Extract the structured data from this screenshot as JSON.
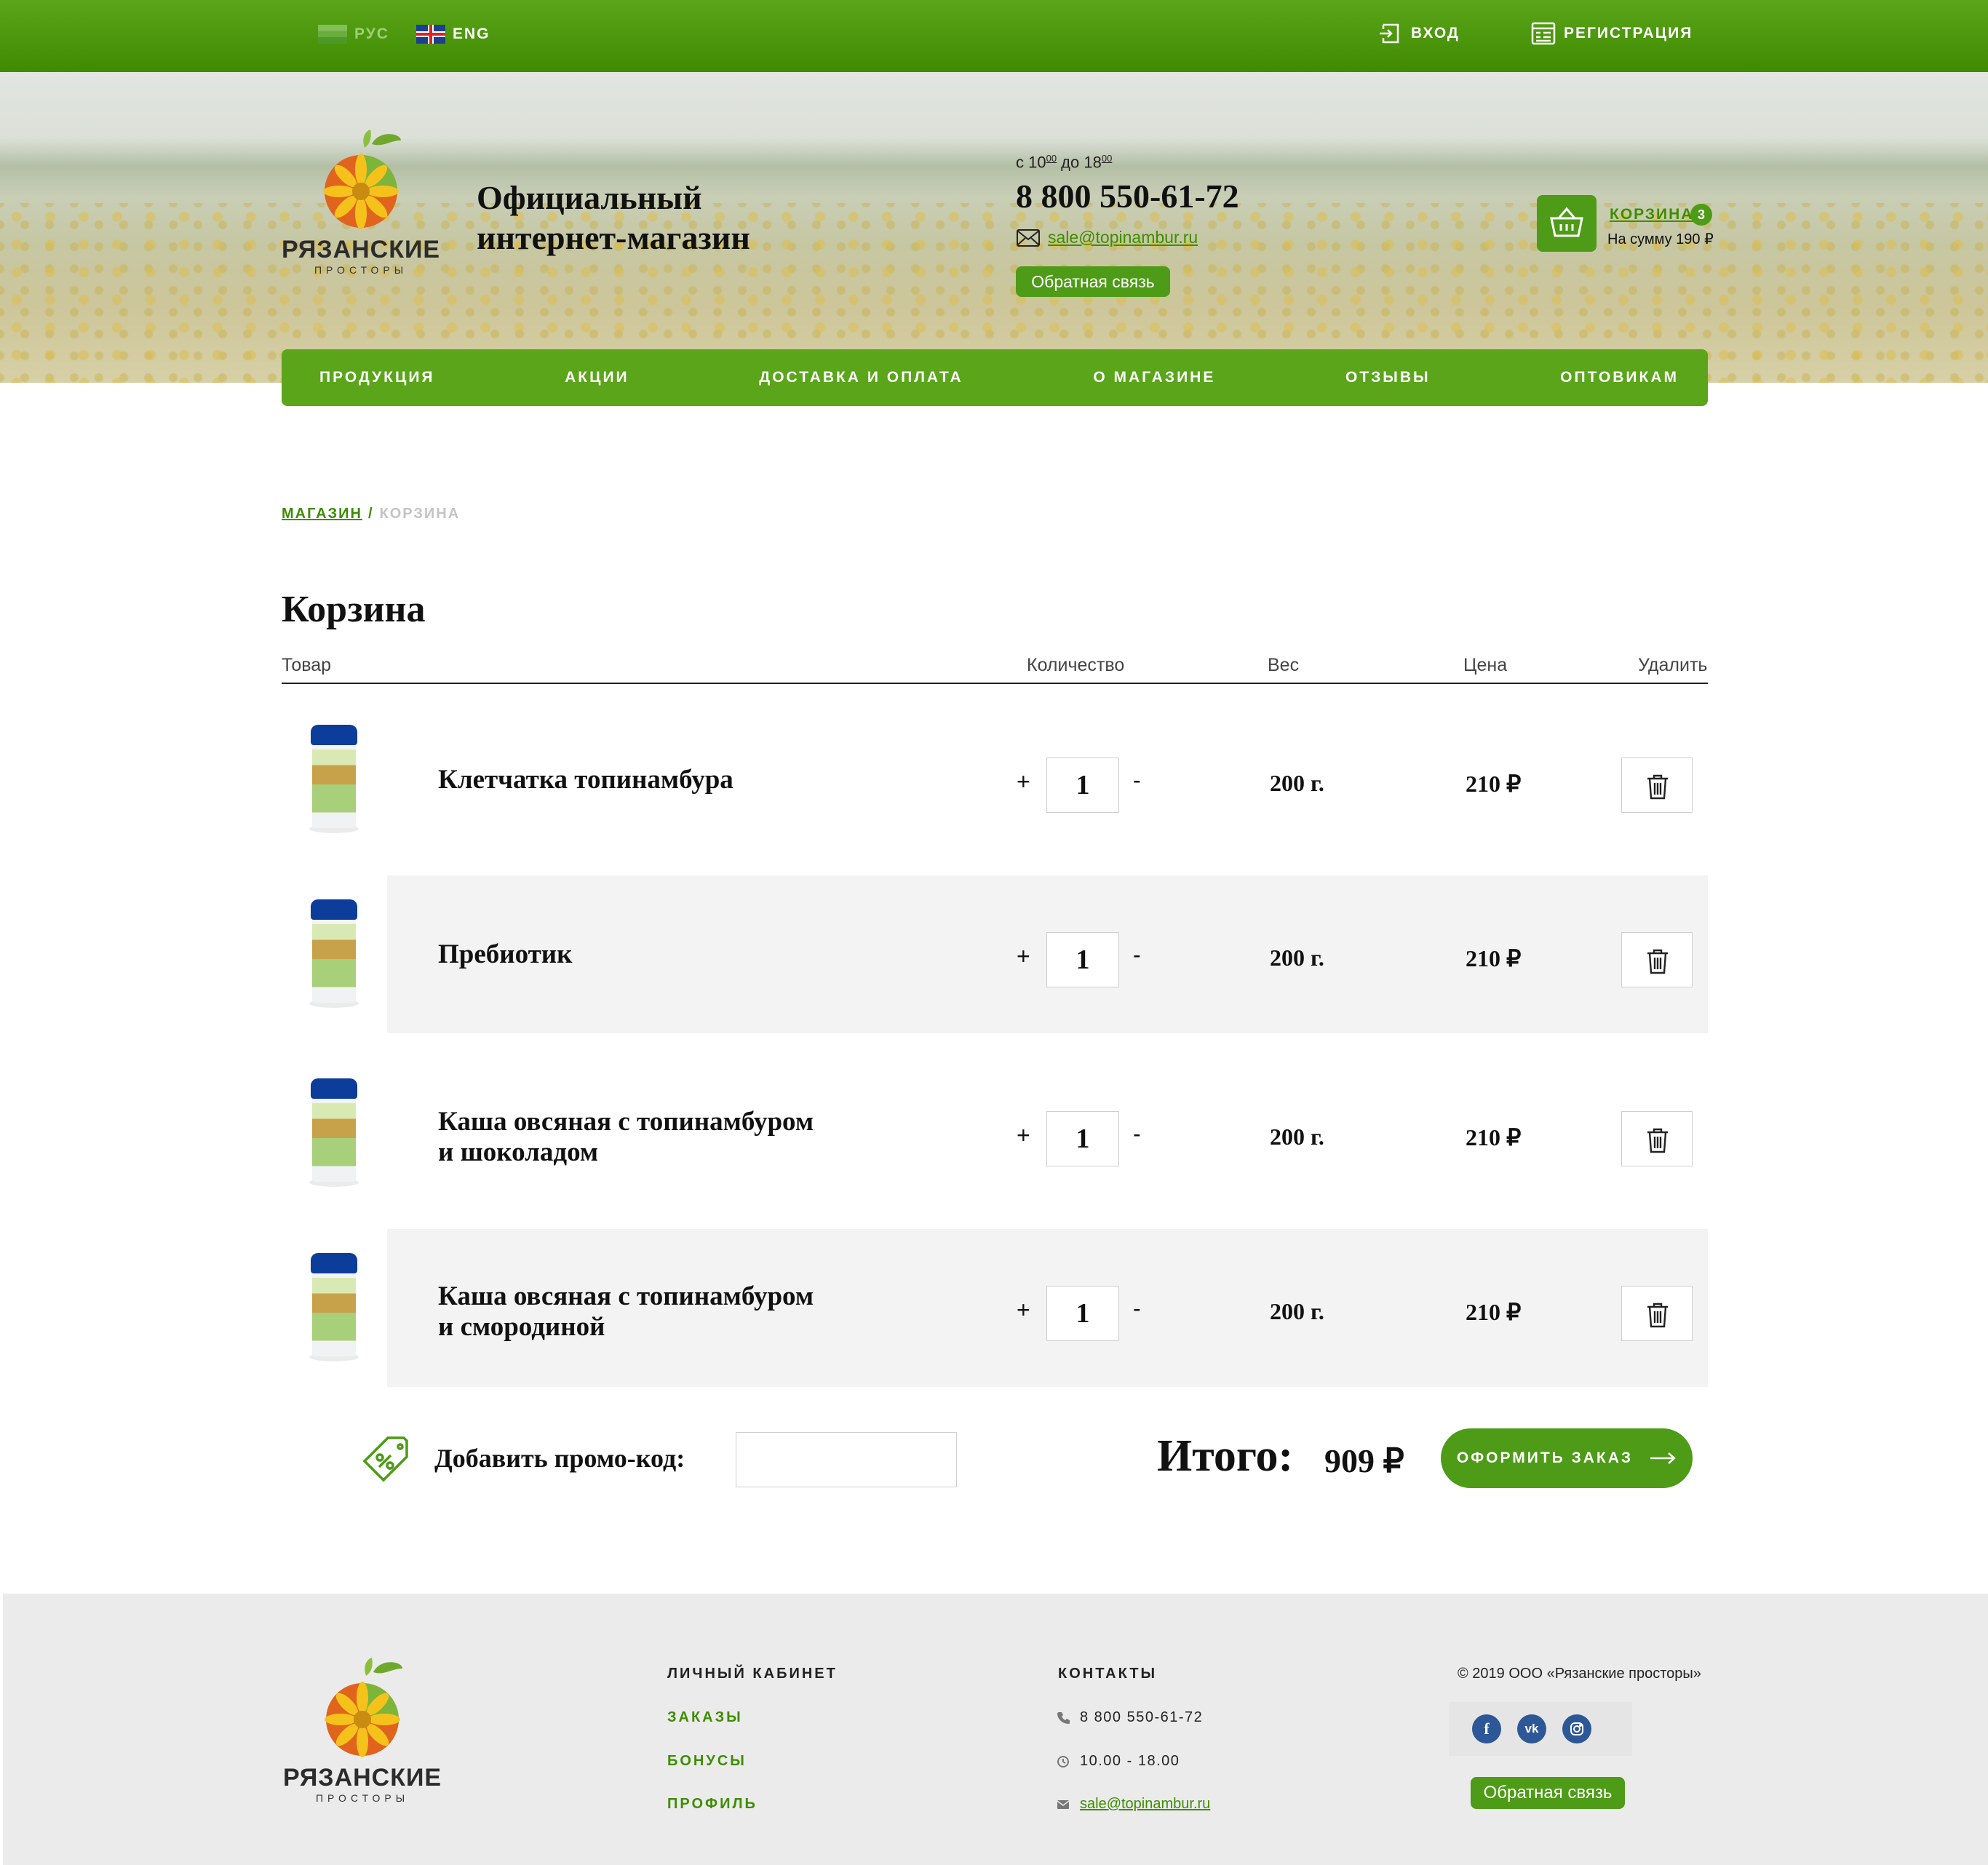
{
  "topbar": {
    "lang_ru": "РУС",
    "lang_en": "ENG",
    "login": "ВХОД",
    "register": "РЕГИСТРАЦИЯ"
  },
  "header": {
    "logo_word": "РЯЗАНСКИЕ",
    "logo_sub": "ПРОСТОРЫ",
    "tagline_line1": "Официальный",
    "tagline_line2": "интернет-магазин",
    "hours_prefix": "с 10",
    "hours_from_min": "00",
    "hours_mid": " до 18",
    "hours_to_min": "00",
    "phone": "8 800 550-61-72",
    "email": "sale@topinambur.ru",
    "feedback": "Обратная связь",
    "cart_label": "КОРЗИНА",
    "cart_count": "3",
    "cart_sum": "На сумму 190 ₽"
  },
  "nav": [
    "ПРОДУКЦИЯ",
    "АКЦИИ",
    "ДОСТАВКА И ОПЛАТА",
    "О МАГАЗИНЕ",
    "ОТЗЫВЫ",
    "ОПТОВИКАМ"
  ],
  "breadcrumb": {
    "shop": "МАГАЗИН",
    "separator": "/",
    "current": "КОРЗИНА"
  },
  "page_title": "Корзина",
  "table": {
    "headers": {
      "product": "Товар",
      "quantity": "Количество",
      "weight": "Вес",
      "price": "Цена",
      "delete": "Удалить"
    },
    "plus": "+",
    "minus": "-",
    "rows": [
      {
        "name_line1": "Клетчатка топинамбура",
        "name_line2": "",
        "qty": "1",
        "weight": "200 г.",
        "price": "210 ₽"
      },
      {
        "name_line1": "Пребиотик",
        "name_line2": "",
        "qty": "1",
        "weight": "200 г.",
        "price": "210 ₽"
      },
      {
        "name_line1": "Каша овсяная с топинамбуром",
        "name_line2": "и шоколадом",
        "qty": "1",
        "weight": "200 г.",
        "price": "210 ₽"
      },
      {
        "name_line1": "Каша овсяная с топинамбуром",
        "name_line2": "и смородиной",
        "qty": "1",
        "weight": "200 г.",
        "price": "210 ₽"
      }
    ]
  },
  "summary": {
    "promo_label": "Добавить промо-код:",
    "promo_value": "",
    "total_label": "Итого:",
    "total_value": "909 ₽",
    "checkout": "ОФОРМИТЬ ЗАКАЗ"
  },
  "footer": {
    "cabinet_title": "ЛИЧНЫЙ КАБИНЕТ",
    "cabinet_links": [
      "ЗАКАЗЫ",
      "БОНУСЫ",
      "ПРОФИЛЬ"
    ],
    "contacts_title": "КОНТАКТЫ",
    "phone": "8 800 550-61-72",
    "hours": "10.00 - 18.00",
    "email": "sale@topinambur.ru",
    "copyright": "© 2019 ООО «Рязанские просторы»",
    "feedback": "Обратная связь"
  },
  "colors": {
    "brand_green": "#4d9b16",
    "link_green": "#3e8d00",
    "row_alt": "#f3f3f3",
    "footer_bg": "#ebebeb"
  },
  "icons": [
    "login-icon",
    "register-icon",
    "mail-icon",
    "basket-icon",
    "trash-icon",
    "promo-tag-icon",
    "arrow-right-icon",
    "phone-icon",
    "clock-icon",
    "facebook-icon",
    "vk-icon",
    "instagram-icon"
  ]
}
